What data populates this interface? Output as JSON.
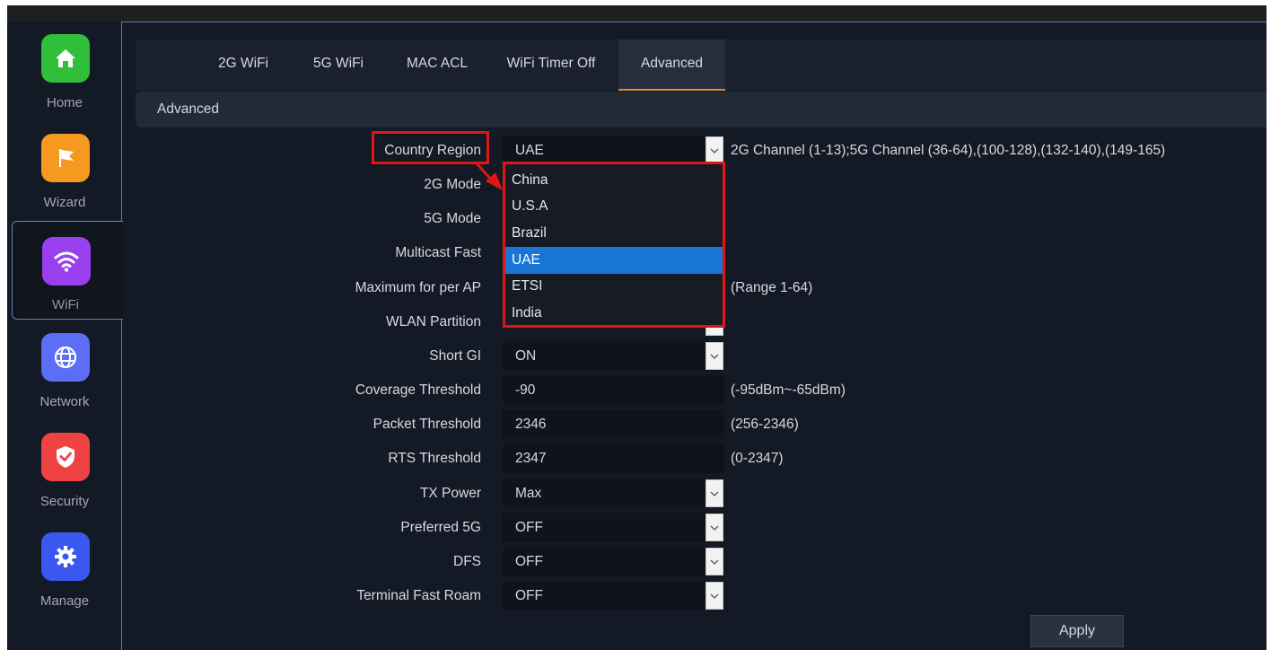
{
  "sidebar": {
    "items": [
      {
        "label": "Home",
        "icon": "home-icon",
        "color": "#2fbf3a"
      },
      {
        "label": "Wizard",
        "icon": "flag-icon",
        "color": "#f49a1f"
      },
      {
        "label": "WiFi",
        "icon": "wifi-icon",
        "color": "#9a3ff0",
        "active": true
      },
      {
        "label": "Network",
        "icon": "globe-icon",
        "color": "#5b6ef5"
      },
      {
        "label": "Security",
        "icon": "shield-icon",
        "color": "#ef4343"
      },
      {
        "label": "Manage",
        "icon": "gear-icon",
        "color": "#3a57f0"
      }
    ]
  },
  "tabs": [
    {
      "label": "2G WiFi"
    },
    {
      "label": "5G WiFi"
    },
    {
      "label": "MAC ACL"
    },
    {
      "label": "WiFi Timer Off"
    },
    {
      "label": "Advanced",
      "active": true
    }
  ],
  "section": {
    "title": "Advanced"
  },
  "form": {
    "country_region": {
      "label": "Country Region",
      "value": "UAE",
      "hint": "2G Channel (1-13);5G Channel (36-64),(100-128),(132-140),(149-165)"
    },
    "mode_2g": {
      "label": "2G Mode"
    },
    "mode_5g": {
      "label": "5G Mode"
    },
    "multicast_fast": {
      "label": "Multicast Fast"
    },
    "max_per_ap": {
      "label": "Maximum for per AP",
      "hint": "(Range 1-64)"
    },
    "wlan_partition": {
      "label": "WLAN Partition"
    },
    "short_gi": {
      "label": "Short GI",
      "value": "ON"
    },
    "coverage_threshold": {
      "label": "Coverage Threshold",
      "value": "-90",
      "hint": "(-95dBm~-65dBm)"
    },
    "packet_threshold": {
      "label": "Packet Threshold",
      "value": "2346",
      "hint": "(256-2346)"
    },
    "rts_threshold": {
      "label": "RTS Threshold",
      "value": "2347",
      "hint": "(0-2347)"
    },
    "tx_power": {
      "label": "TX Power",
      "value": "Max"
    },
    "preferred_5g": {
      "label": "Preferred 5G",
      "value": "OFF"
    },
    "dfs": {
      "label": "DFS",
      "value": "OFF"
    },
    "terminal_fast_roam": {
      "label": "Terminal Fast Roam",
      "value": "OFF"
    }
  },
  "dropdown": {
    "options": [
      "China",
      "U.S.A",
      "Brazil",
      "UAE",
      "ETSI",
      "India"
    ],
    "selected": "UAE"
  },
  "apply_label": "Apply",
  "colors": {
    "highlight": "#e01515",
    "selected": "#1976d6",
    "tab_underline": "#e08a2a"
  }
}
